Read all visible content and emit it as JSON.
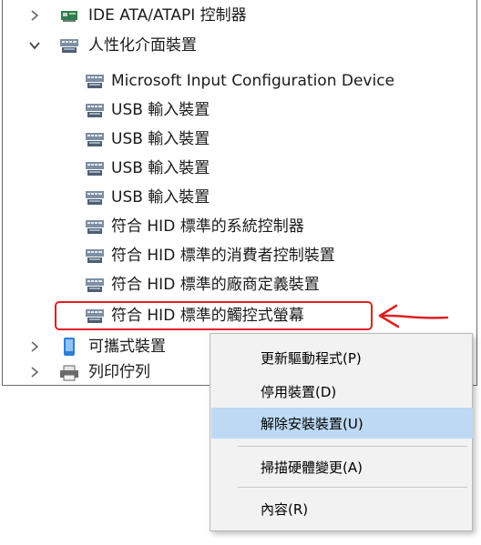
{
  "tree": {
    "ide_controllers": {
      "label": "IDE ATA/ATAPI 控制器",
      "expanded": false,
      "icon": "ide-controller-icon"
    },
    "hid_group": {
      "label": "人性化介面裝置",
      "expanded": true,
      "icon": "hid-device-icon",
      "children": [
        "Microsoft Input Configuration Device",
        "USB 輸入裝置",
        "USB 輸入裝置",
        "USB 輸入裝置",
        "USB 輸入裝置",
        "符合 HID 標準的系統控制器",
        "符合 HID 標準的消費者控制裝置",
        "符合 HID 標準的廠商定義裝置",
        "符合 HID 標準的觸控式螢幕"
      ],
      "selected_child_index": 8
    },
    "portable_devices": {
      "label": "可攜式裝置",
      "expanded": false,
      "icon": "portable-device-icon"
    },
    "print_queues": {
      "label": "列印佇列",
      "expanded": false,
      "icon": "printer-icon"
    }
  },
  "context_menu": {
    "items": [
      {
        "label": "更新驅動程式(P)"
      },
      {
        "label": "停用裝置(D)"
      },
      {
        "label": "解除安裝裝置(U)",
        "highlighted": true
      },
      {
        "label": "掃描硬體變更(A)"
      },
      {
        "label": "內容(R)"
      }
    ]
  },
  "annotation": {
    "color": "#e02020"
  },
  "colors": {
    "menu_bg": "#f2f2f2",
    "menu_highlight": "#bdd9f3",
    "accent_blue": "#2f7fd6"
  }
}
